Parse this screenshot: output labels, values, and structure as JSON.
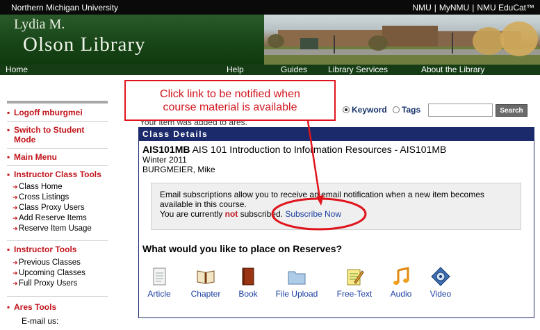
{
  "topbar": {
    "university": "Northern Michigan University",
    "links": [
      "NMU",
      "MyNMU",
      "NMU EduCat™"
    ]
  },
  "banner": {
    "title_line1": "Lydia M.",
    "title_line2": "Olson Library"
  },
  "nav": {
    "items": [
      "Home",
      "Help",
      "Guides",
      "Library Services",
      "About the Library"
    ]
  },
  "sidebar": {
    "logoff": "Logoff mburgmei",
    "switch": "Switch to Student Mode",
    "main_menu": "Main Menu",
    "instructor_class_tools": {
      "label": "Instructor Class Tools",
      "items": [
        "Class Home",
        "Cross Listings",
        "Class Proxy Users",
        "Add Reserve Items",
        "Reserve Item Usage"
      ]
    },
    "instructor_tools": {
      "label": "Instructor Tools",
      "items": [
        "Previous Classes",
        "Upcoming Classes",
        "Full Proxy Users"
      ]
    },
    "ares_tools": {
      "label": "Ares Tools",
      "items": [
        "E-mail us:"
      ]
    }
  },
  "search": {
    "option_keyword": "Keyword",
    "option_tags": "Tags",
    "selected": "Keyword",
    "input_value": "",
    "button_label": "Search"
  },
  "status_text": "Your item was added to ares.",
  "class_details": {
    "header": "Class Details",
    "course_code": "AIS101MB",
    "course_title": " AIS 101 Introduction to Information Resources - AIS101MB",
    "term": "Winter 2011",
    "instructor": "BURGMEIER, Mike",
    "notice_line1": "Email subscriptions allow you to receive an email notification when a new item becomes available in this course.",
    "notice_prefix": "You are currently ",
    "notice_not": "not",
    "notice_suffix": " subscribed. ",
    "subscribe_link": "Subscribe Now",
    "question": "What would you like to place on Reserves?",
    "tools": [
      "Article",
      "Chapter",
      "Book",
      "File Upload",
      "Free-Text",
      "Audio",
      "Video"
    ]
  },
  "callout": {
    "line1": "Click link to be notified when",
    "line2": "course material is available",
    "color": "#e0141c"
  },
  "colors": {
    "accent_red": "#c2141c",
    "header_navy": "#1b2a6b",
    "link_blue": "#1b3fa0",
    "banner_green": "#174417"
  }
}
